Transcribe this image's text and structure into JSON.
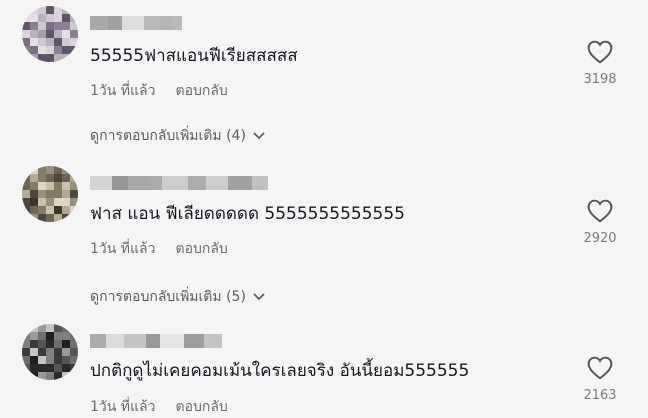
{
  "comments": [
    {
      "text": "55555ฟาสแอนฟีเรียสสสสส",
      "time": "1วัน ที่แล้ว",
      "reply_label": "ตอบกลับ",
      "likes": "3198",
      "view_replies": "ดูการตอบกลับเพิ่มเติม (4)"
    },
    {
      "text": "ฟาส แอน ฟีเลียดดดดด 5555555555555",
      "time": "1วัน ที่แล้ว",
      "reply_label": "ตอบกลับ",
      "likes": "2920",
      "view_replies": "ดูการตอบกลับเพิ่มเติม (5)"
    },
    {
      "text": "ปกติกูดูไม่เคยคอมเม้นใครเลยจริง อันนี้ยอม555555",
      "time": "1วัน ที่แล้ว",
      "reply_label": "ตอบกลับ",
      "likes": "2163"
    }
  ],
  "icons": {
    "like": "heart-icon",
    "expand": "chevron-down-icon"
  },
  "colors": {
    "background": "#f5f5f5",
    "text": "#161823",
    "meta": "#6b6b70"
  }
}
